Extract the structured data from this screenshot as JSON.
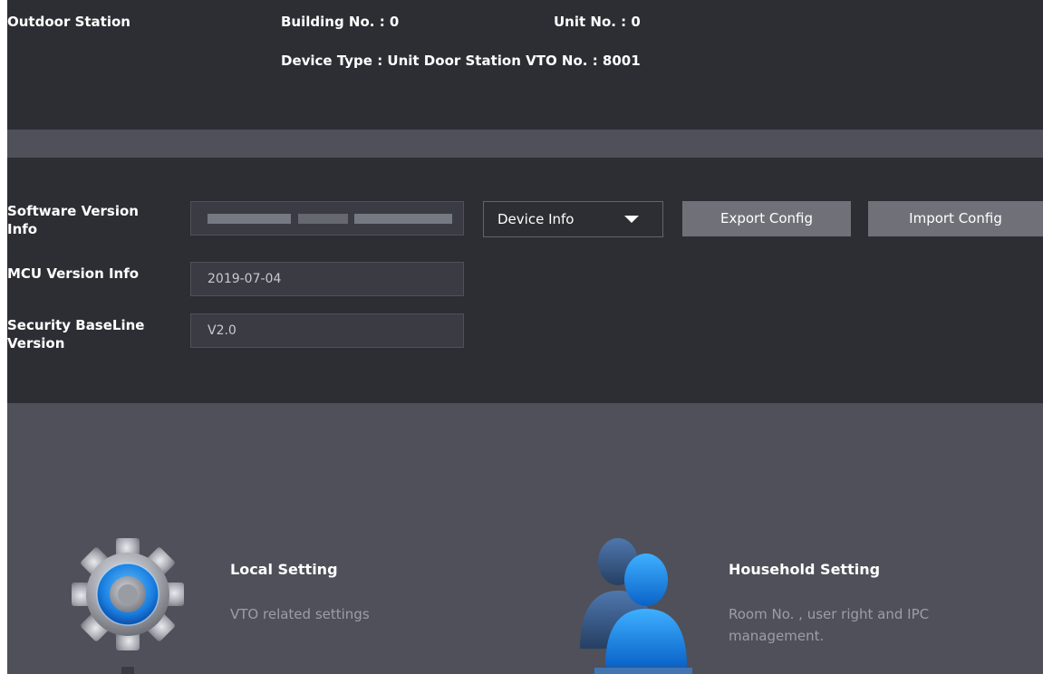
{
  "header": {
    "station_type": "Outdoor Station",
    "building_no": "Building No. : 0",
    "unit_no": "Unit No. : 0",
    "device_type": "Device Type : Unit Door Station VTO No. : 8001"
  },
  "info": {
    "software_version_label": "Software Version Info",
    "software_version_value": "",
    "mcu_version_label": "MCU Version Info",
    "mcu_version_value": "2019-07-04",
    "security_baseline_label": "Security BaseLine Version",
    "security_baseline_value": "V2.0",
    "select_value": "Device Info",
    "export_label": "Export Config",
    "import_label": "Import Config"
  },
  "tiles": [
    {
      "title": "Local Setting",
      "desc": "VTO related settings",
      "icon": "gear-icon"
    },
    {
      "title": "Household Setting",
      "desc": "Room No. , user right and IPC management.",
      "icon": "users-icon"
    }
  ],
  "colors": {
    "panel_bg": "#2d2e33",
    "separator_bg": "#4f5059",
    "button_bg": "#707178",
    "accent_blue": "#1f86e0"
  }
}
